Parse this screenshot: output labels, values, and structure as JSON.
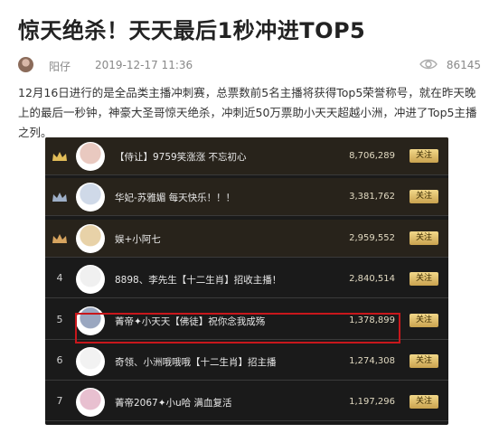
{
  "article": {
    "title": "惊天绝杀！天天最后1秒冲进TOP5",
    "author": "阳仔",
    "date": "2019-12-17 11:36",
    "views": "86145",
    "paragraph": "12月16日进行的是全品类主播冲刺赛，总票数前5名主播将获得Top5荣誉称号，就在昨天晚上的最后一秒钟，神豪大圣哥惊天绝杀，冲刺近50万票助小天天超越小洲，冲进了Top5主播之列。"
  },
  "icons": {
    "avatar": "author-avatar",
    "views": "eye-icon",
    "rank_top": "crown-icon"
  },
  "leaderboard": {
    "follow_label": "关注",
    "rows": [
      {
        "rank": "",
        "crown": "gold",
        "name": "【侍让】9759笑涨涨 不忘初心",
        "score": "8,706,289",
        "avatar_color": "#e9c9c0"
      },
      {
        "rank": "",
        "crown": "silver",
        "name": "华妃-苏雅媚 每天快乐！！！",
        "score": "3,381,762",
        "avatar_color": "#cfd9e8"
      },
      {
        "rank": "",
        "crown": "bronze",
        "name": "娱+小阿七",
        "score": "2,959,552",
        "avatar_color": "#e8d2a8"
      },
      {
        "rank": "4",
        "crown": "",
        "name": "8898、李先生【十二生肖】招收主播！",
        "score": "2,840,514",
        "avatar_color": "#f0f0f0"
      },
      {
        "rank": "5",
        "crown": "",
        "name": "菁帝✦小天天【佛徒】祝你念我成殇",
        "score": "1,378,899",
        "avatar_color": "#9aa7c0"
      },
      {
        "rank": "6",
        "crown": "",
        "name": "奇领、小洲哦哦哦【十二生肖】招主播",
        "score": "1,274,308",
        "avatar_color": "#f2f2f2"
      },
      {
        "rank": "7",
        "crown": "",
        "name": "菁帝2067✦小u哈 满血复活",
        "score": "1,197,296",
        "avatar_color": "#e8c0d0"
      }
    ]
  },
  "colors": {
    "panel_bg": "#1a1a1a",
    "top_row_bg": "#28231b",
    "gold": "#d6b35a",
    "highlight_border": "#c8171c",
    "follow_button": "#e3c373"
  }
}
